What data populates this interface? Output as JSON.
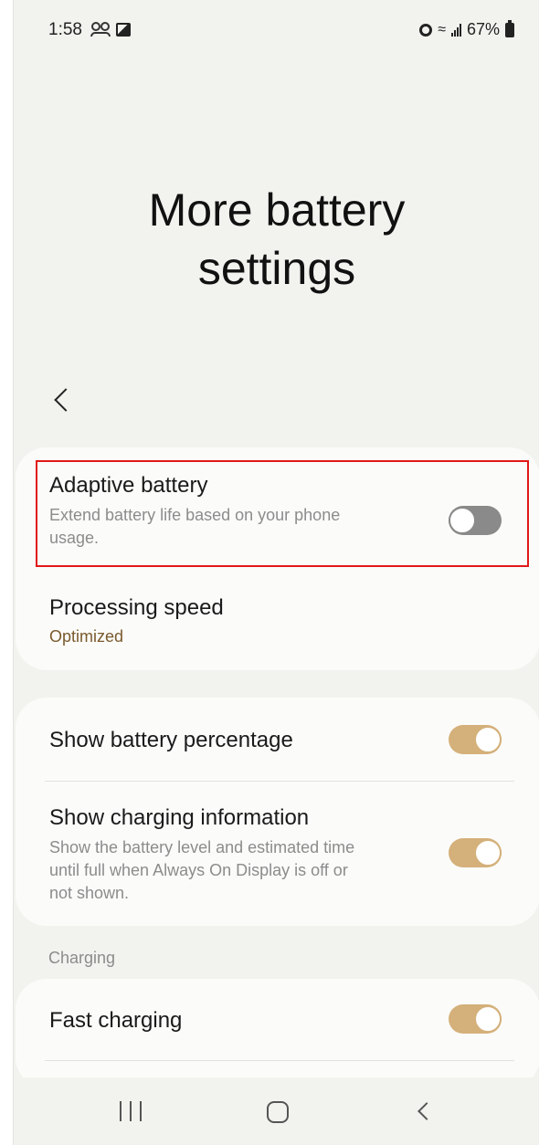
{
  "status_bar": {
    "time": "1:58",
    "battery_percent": "67%",
    "icons_left": [
      "people-icon",
      "gallery-icon"
    ],
    "icons_right": [
      "alarm-icon",
      "wifi-icon",
      "signal-icon",
      "battery-icon"
    ]
  },
  "page": {
    "title": "More battery\nsettings"
  },
  "card1": {
    "adaptive_battery": {
      "title": "Adaptive battery",
      "subtitle": "Extend battery life based on your phone\nusage.",
      "enabled": false
    },
    "processing_speed": {
      "title": "Processing speed",
      "value": "Optimized"
    }
  },
  "card2": {
    "show_battery_percentage": {
      "title": "Show battery percentage",
      "enabled": true
    },
    "show_charging_information": {
      "title": "Show charging information",
      "subtitle": "Show the battery level and estimated time\nuntil full when Always On Display is off or\nnot shown.",
      "enabled": true
    }
  },
  "charging_section": {
    "header": "Charging",
    "fast_charging": {
      "title": "Fast charging",
      "enabled": true
    }
  },
  "colors": {
    "accent": "#d4b07a",
    "highlight": "#e01818",
    "value_text": "#7a5a2e"
  },
  "nav_bar": {
    "buttons": [
      "recents-button",
      "home-button",
      "back-button"
    ]
  }
}
